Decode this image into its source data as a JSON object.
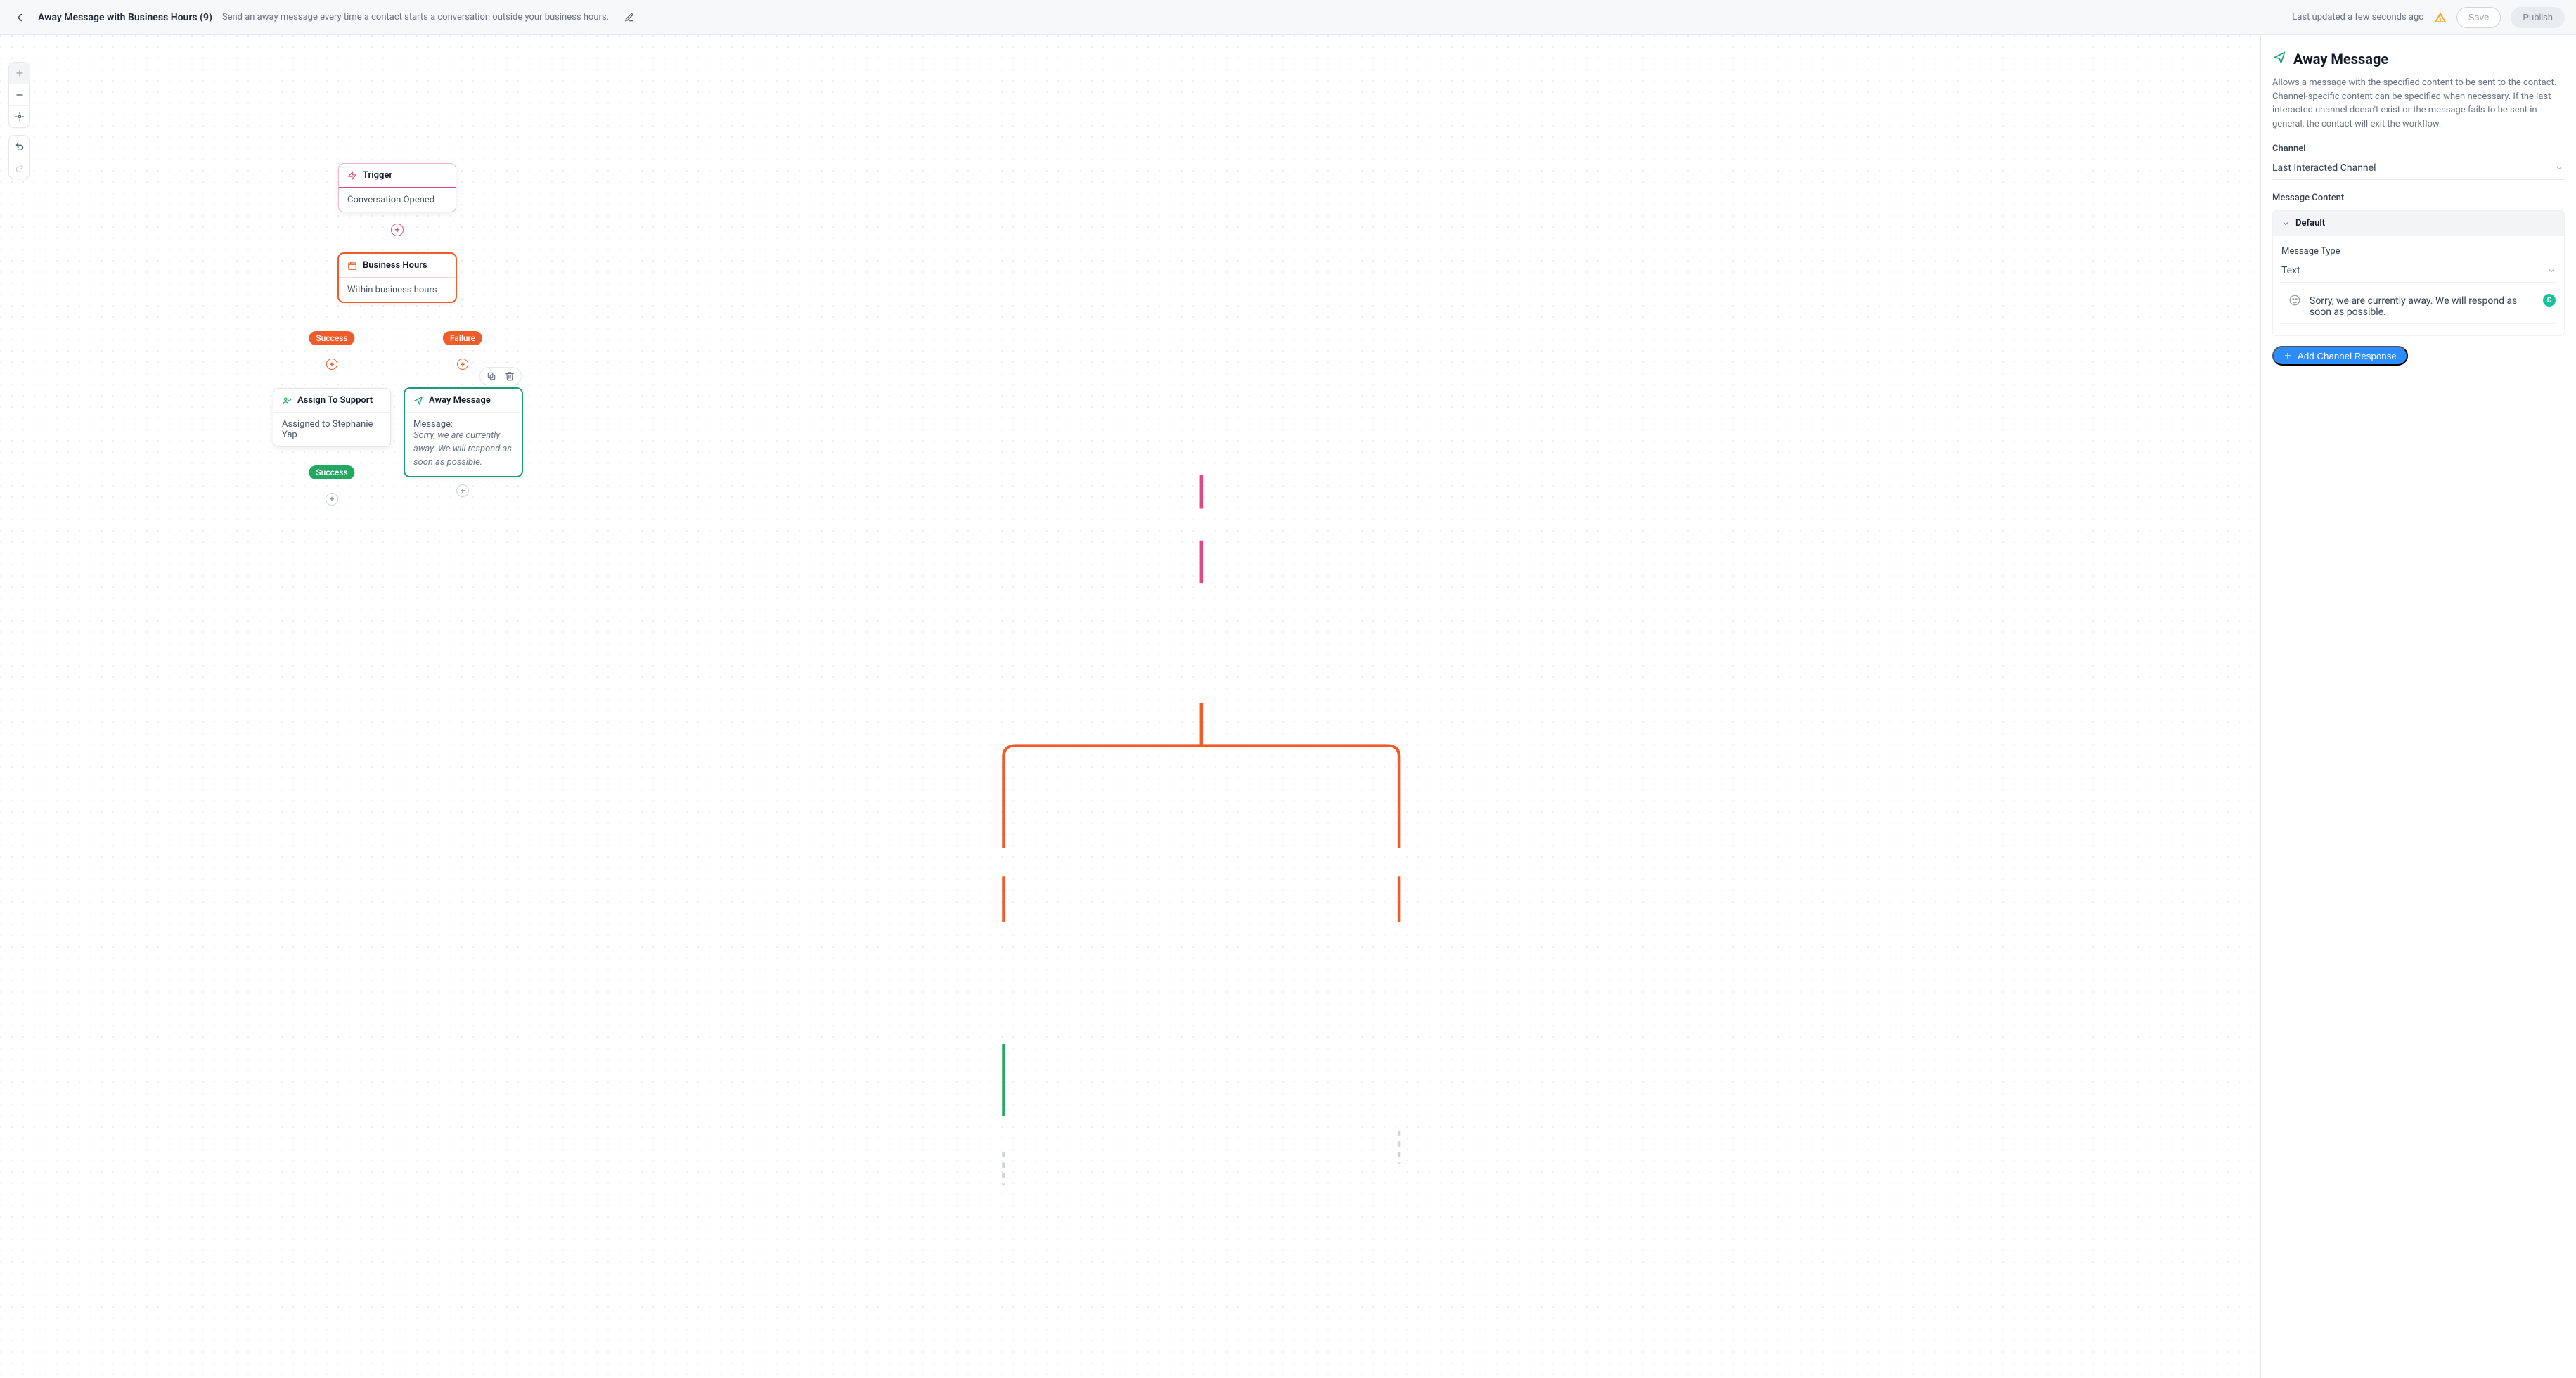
{
  "header": {
    "title": "Away Message with Business Hours (9)",
    "subtitle": "Send an away message every time a contact starts a conversation outside your business hours.",
    "status": "Last updated a few seconds ago",
    "save_label": "Save",
    "publish_label": "Publish"
  },
  "canvas": {
    "trigger_title": "Trigger",
    "trigger_sub": "Conversation Opened",
    "bh_title": "Business Hours",
    "bh_sub": "Within business hours",
    "success_label": "Success",
    "failure_label": "Failure",
    "assign_title": "Assign To Support",
    "assign_sub": "Assigned to Stephanie Yap",
    "away_title": "Away Message",
    "away_msg_label": "Message:",
    "away_msg_text": "Sorry, we are currently away. We will respond as soon as possible."
  },
  "panel": {
    "title": "Away Message",
    "desc": "Allows a message with the specified content to be sent to the contact. Channel-specific content can be specified when necessary. If the last interacted channel doesn't exist or the message fails to be sent in general, the contact will exit the workflow.",
    "channel_label": "Channel",
    "channel_value": "Last Interacted Channel",
    "msg_content_label": "Message Content",
    "default_label": "Default",
    "msg_type_label": "Message Type",
    "msg_type_value": "Text",
    "msg_text": "Sorry, we are currently away. We will respond as soon as possible.",
    "add_channel_label": "Add Channel Response"
  }
}
